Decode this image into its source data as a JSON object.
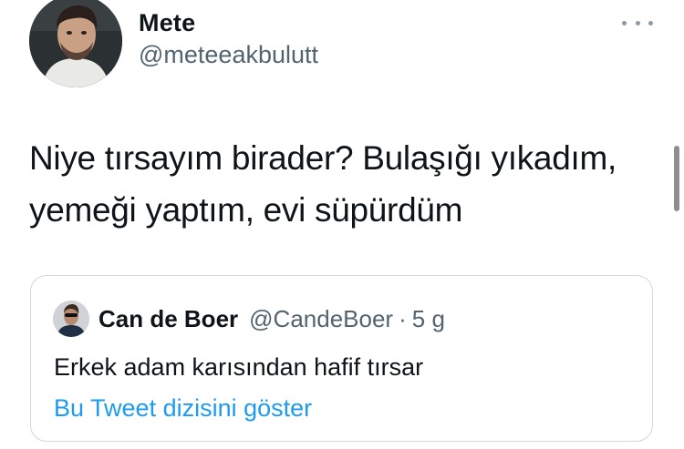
{
  "tweet": {
    "author": {
      "name": "Mete",
      "handle": "@meteeakbulutt"
    },
    "text_lines": [
      "Niye tırsayım birader? Bulaşığı yıkadım,",
      "yemeği yaptım, evi süpürdüm"
    ],
    "more_icon": "more-horizontal-icon"
  },
  "quoted_tweet": {
    "author": {
      "name": "Can de Boer",
      "handle": "@CandeBoer"
    },
    "separator": "·",
    "time": "5 g",
    "text": "Erkek adam karısından hafif tırsar",
    "thread_link": "Bu Tweet dizisini göster"
  },
  "colors": {
    "text_primary": "#0f1419",
    "text_secondary": "#536471",
    "link": "#1d9bf0",
    "card_border": "#cfd9de"
  }
}
